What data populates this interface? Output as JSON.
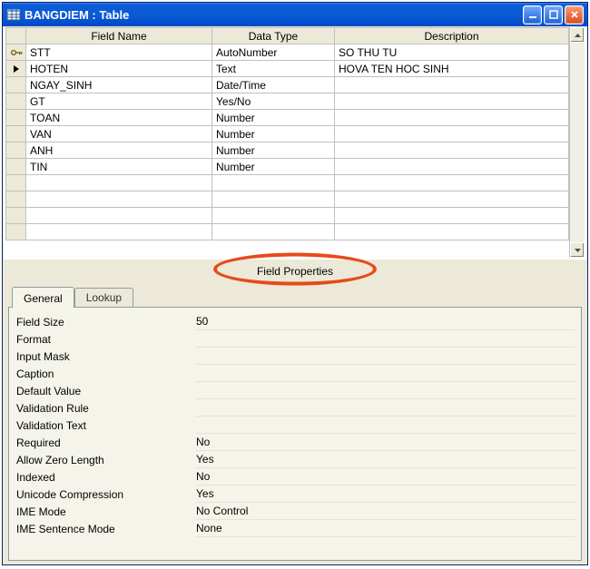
{
  "window": {
    "title": "BANGDIEM : Table"
  },
  "grid": {
    "headers": {
      "field_name": "Field Name",
      "data_type": "Data Type",
      "description": "Description"
    },
    "rows": [
      {
        "marker": "key",
        "field": "STT",
        "type": "AutoNumber",
        "desc": "SO THU TU"
      },
      {
        "marker": "arrow",
        "field": "HOTEN",
        "type": "Text",
        "desc": "HOVA TEN HOC SINH"
      },
      {
        "marker": "",
        "field": "NGAY_SINH",
        "type": "Date/Time",
        "desc": ""
      },
      {
        "marker": "",
        "field": "GT",
        "type": "Yes/No",
        "desc": ""
      },
      {
        "marker": "",
        "field": "TOAN",
        "type": "Number",
        "desc": ""
      },
      {
        "marker": "",
        "field": "VAN",
        "type": "Number",
        "desc": ""
      },
      {
        "marker": "",
        "field": "ANH",
        "type": "Number",
        "desc": ""
      },
      {
        "marker": "",
        "field": "TIN",
        "type": "Number",
        "desc": ""
      },
      {
        "marker": "",
        "field": "",
        "type": "",
        "desc": ""
      },
      {
        "marker": "",
        "field": "",
        "type": "",
        "desc": ""
      },
      {
        "marker": "",
        "field": "",
        "type": "",
        "desc": ""
      },
      {
        "marker": "",
        "field": "",
        "type": "",
        "desc": ""
      }
    ]
  },
  "section_title": "Field Properties",
  "tabs": {
    "general": "General",
    "lookup": "Lookup"
  },
  "props": [
    {
      "label": "Field Size",
      "value": "50"
    },
    {
      "label": "Format",
      "value": ""
    },
    {
      "label": "Input Mask",
      "value": ""
    },
    {
      "label": "Caption",
      "value": ""
    },
    {
      "label": "Default Value",
      "value": ""
    },
    {
      "label": "Validation Rule",
      "value": ""
    },
    {
      "label": "Validation Text",
      "value": ""
    },
    {
      "label": "Required",
      "value": "No"
    },
    {
      "label": "Allow Zero Length",
      "value": "Yes"
    },
    {
      "label": "Indexed",
      "value": "No"
    },
    {
      "label": "Unicode Compression",
      "value": "Yes"
    },
    {
      "label": "IME Mode",
      "value": "No Control"
    },
    {
      "label": "IME Sentence Mode",
      "value": "None"
    }
  ]
}
